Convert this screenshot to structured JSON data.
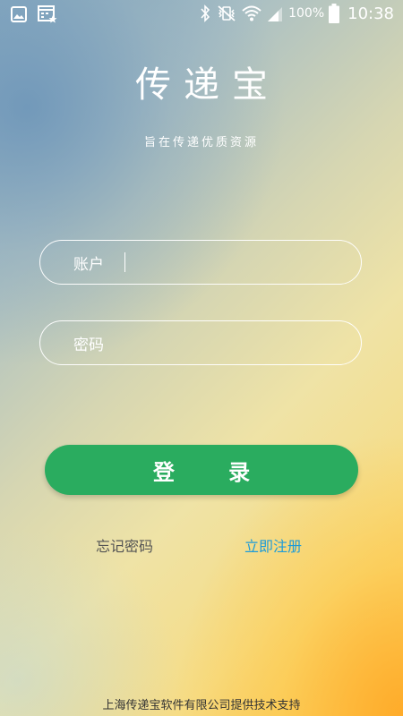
{
  "status_bar": {
    "battery_percent": "100%",
    "time": "10:38",
    "icons": [
      "gallery-icon",
      "calendar-star-icon",
      "bluetooth-icon",
      "vibrate-mute-icon",
      "wifi-icon",
      "signal-icon",
      "battery-icon"
    ]
  },
  "header": {
    "title": "传递宝",
    "subtitle": "旨在传递优质资源"
  },
  "form": {
    "account_label": "账户",
    "account_value": "",
    "password_label": "密码",
    "password_value": ""
  },
  "actions": {
    "login_label": "登 录",
    "forgot_password": "忘记密码",
    "register": "立即注册"
  },
  "footer": {
    "text": "上海传递宝软件有限公司提供技术支持"
  },
  "colors": {
    "login_button": "#2aac5f",
    "register_link": "#1c9bd9"
  }
}
